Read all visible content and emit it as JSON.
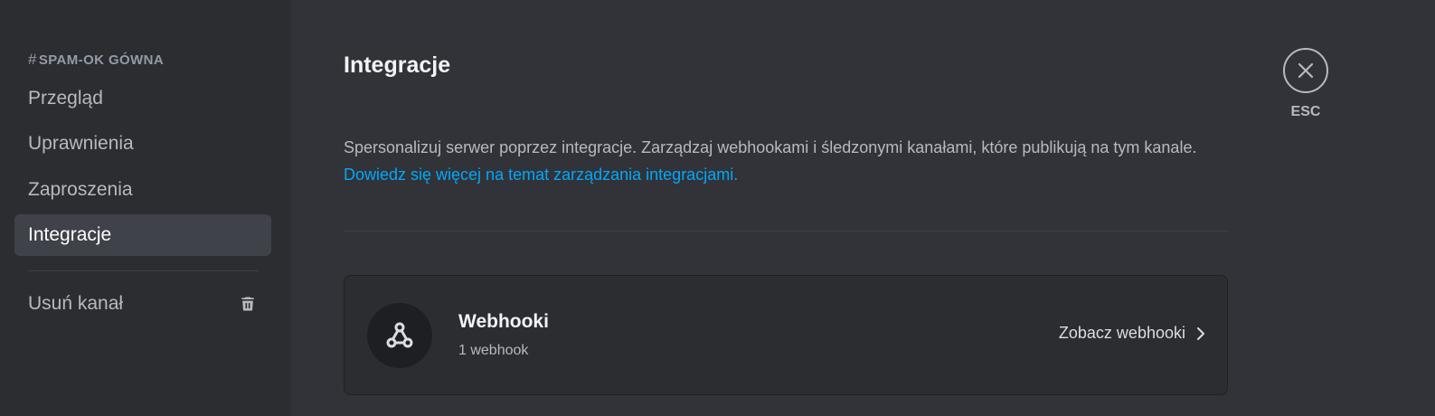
{
  "sidebar": {
    "header_hash": "#",
    "header": "spam-ok gówna",
    "items": [
      {
        "label": "Przegląd"
      },
      {
        "label": "Uprawnienia"
      },
      {
        "label": "Zaproszenia"
      },
      {
        "label": "Integracje",
        "selected": true
      }
    ],
    "delete_label": "Usuń kanał",
    "delete_icon": "trash-icon"
  },
  "main": {
    "title": "Integracje",
    "description": "Spersonalizuj serwer poprzez integracje. Zarządzaj webhookami i śledzonymi kanałami, które publikują na tym kanale.",
    "learn_more": "Dowiedz się więcej na temat zarządzania integracjami.",
    "webhooks_card": {
      "icon": "webhook-icon",
      "title": "Webhooki",
      "subtitle": "1 webhook",
      "action": "Zobacz webhooki"
    }
  },
  "close": {
    "label": "ESC",
    "icon": "close-icon"
  },
  "colors": {
    "accent_link": "#00a8fc",
    "background": "#313338",
    "sidebar": "#2b2d31",
    "selected": "#404249"
  }
}
